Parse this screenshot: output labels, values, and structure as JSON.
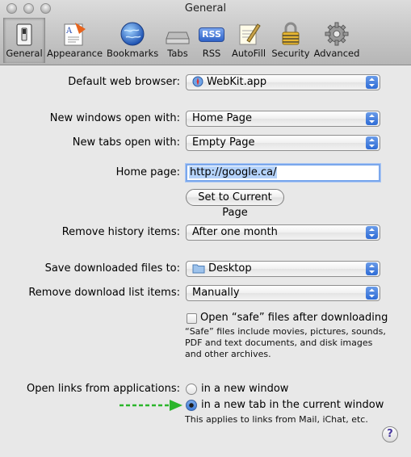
{
  "window": {
    "title": "General"
  },
  "toolbar": {
    "items": [
      {
        "label": "General",
        "icon": "general-switch-icon",
        "selected": true
      },
      {
        "label": "Appearance",
        "icon": "appearance-icon",
        "selected": false
      },
      {
        "label": "Bookmarks",
        "icon": "bookmarks-globe-icon",
        "selected": false
      },
      {
        "label": "Tabs",
        "icon": "tabs-icon",
        "selected": false
      },
      {
        "label": "RSS",
        "icon": "rss-icon",
        "selected": false
      },
      {
        "label": "AutoFill",
        "icon": "autofill-pen-icon",
        "selected": false
      },
      {
        "label": "Security",
        "icon": "security-lock-icon",
        "selected": false
      },
      {
        "label": "Advanced",
        "icon": "advanced-gear-icon",
        "selected": false
      }
    ],
    "rss_badge": "RSS"
  },
  "settings": {
    "default_browser": {
      "label": "Default web browser:",
      "value": "WebKit.app"
    },
    "new_windows": {
      "label": "New windows open with:",
      "value": "Home Page"
    },
    "new_tabs": {
      "label": "New tabs open with:",
      "value": "Empty Page"
    },
    "home_page": {
      "label": "Home page:",
      "value": "http://google.ca/",
      "button": "Set to Current Page"
    },
    "remove_history": {
      "label": "Remove history items:",
      "value": "After one month"
    },
    "save_downloads": {
      "label": "Save downloaded files to:",
      "value": "Desktop"
    },
    "remove_download_list": {
      "label": "Remove download list items:",
      "value": "Manually"
    },
    "open_safe_files": {
      "label": "Open “safe” files after downloading",
      "checked": false,
      "description_lines": [
        "“Safe” files include movies, pictures, sounds,",
        "PDF and text documents, and disk images",
        "and other archives."
      ]
    },
    "open_links": {
      "label": "Open links from applications:",
      "options": [
        {
          "label": "in a new window",
          "selected": false
        },
        {
          "label": "in a new tab in the current window",
          "selected": true
        }
      ],
      "note": "This applies to links from Mail, iChat, etc."
    }
  },
  "help_button": "?",
  "colors": {
    "accent_blue": "#2e6cd6",
    "annotation_arrow": "#2bb52b"
  }
}
